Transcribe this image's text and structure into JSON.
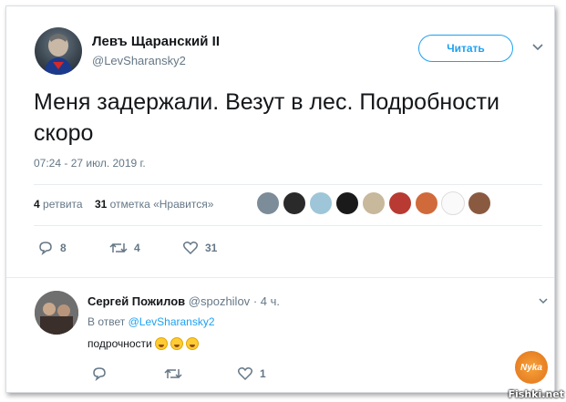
{
  "tweet": {
    "author_name": "Левъ Щаранский II",
    "author_handle": "@LevSharansky2",
    "follow_label": "Читать",
    "text": "Меня задержали. Везут в лес. Подробности скоро",
    "timestamp": "07:24 - 27 июл. 2019 г.",
    "retweets_count": "4",
    "retweets_label": "ретвита",
    "likes_count": "31",
    "likes_label": "отметка «Нравится»",
    "actions": {
      "replies": "8",
      "retweets": "4",
      "likes": "31"
    }
  },
  "reply": {
    "author_name": "Сергей Пожилов",
    "author_handle": "@spozhilov",
    "time": "· 4 ч.",
    "in_reply_prefix": "В ответ",
    "in_reply_handle": "@LevSharansky2",
    "text": "подрочности",
    "actions": {
      "replies": "",
      "retweets": "",
      "likes": "1"
    }
  },
  "watermark": "Fishki.net",
  "logo_text": "Nyka",
  "colors": {
    "accent": "#1da1f2",
    "muted": "#657786",
    "text": "#14171a"
  }
}
